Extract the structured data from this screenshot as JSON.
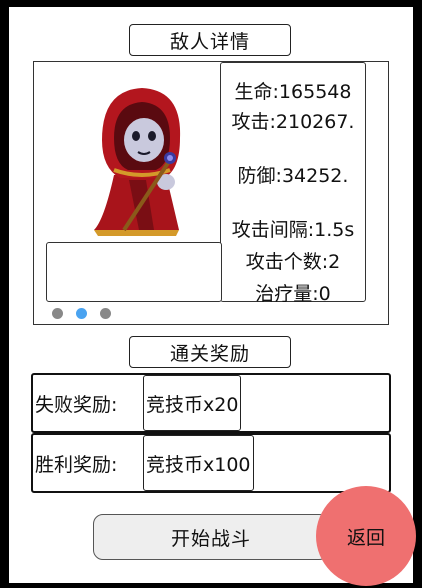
{
  "header": {
    "title": "敌人详情"
  },
  "enemy": {
    "portrait_icon": "hooded-mage-icon",
    "stats": {
      "hp": "生命:165548",
      "atk": "攻击:210267.",
      "def": "防御:34252.",
      "interval": "攻击间隔:1.5s",
      "targets": "攻击个数:2",
      "heal": "治疗量:0"
    },
    "description": ""
  },
  "reward_section": {
    "title": "通关奖励"
  },
  "rewards": [
    {
      "label": "失败奖励:",
      "item": "竞技币x20"
    },
    {
      "label": "胜利奖励:",
      "item": "竞技币x100"
    }
  ],
  "actions": {
    "start": "开始战斗",
    "back": "返回"
  },
  "colors": {
    "active_dot": "#4aa3f0",
    "back_button": "#ef7070"
  }
}
